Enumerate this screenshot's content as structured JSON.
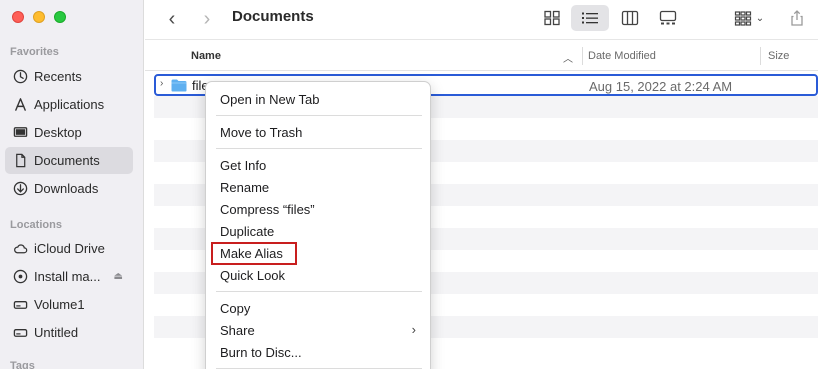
{
  "sidebar": {
    "favorites_title": "Favorites",
    "favorites": [
      {
        "label": "Recents",
        "icon": "clock-icon"
      },
      {
        "label": "Applications",
        "icon": "applications-icon"
      },
      {
        "label": "Desktop",
        "icon": "desktop-icon"
      },
      {
        "label": "Documents",
        "icon": "document-icon",
        "selected": true
      },
      {
        "label": "Downloads",
        "icon": "download-icon"
      }
    ],
    "locations_title": "Locations",
    "locations": [
      {
        "label": "iCloud Drive",
        "icon": "cloud-icon"
      },
      {
        "label": "Install ma...",
        "icon": "disk-icon"
      },
      {
        "label": "Volume1",
        "icon": "drive-icon"
      },
      {
        "label": "Untitled",
        "icon": "drive-icon"
      }
    ],
    "tags_title": "Tags"
  },
  "toolbar": {
    "title": "Documents"
  },
  "columns": {
    "name": "Name",
    "date_modified": "Date Modified",
    "size": "Size"
  },
  "file": {
    "name": "files",
    "date": "Aug 15, 2022 at 2:24 AM"
  },
  "context_menu": {
    "open_new_tab": "Open in New Tab",
    "move_to_trash": "Move to Trash",
    "get_info": "Get Info",
    "rename": "Rename",
    "compress": "Compress “files”",
    "duplicate": "Duplicate",
    "make_alias": "Make Alias",
    "quick_look": "Quick Look",
    "copy": "Copy",
    "share": "Share",
    "burn": "Burn to Disc..."
  },
  "colors": {
    "selection_border": "#2a5bd7",
    "highlight_box": "#c81e1e",
    "folder_blue": "#5fb0f0"
  }
}
